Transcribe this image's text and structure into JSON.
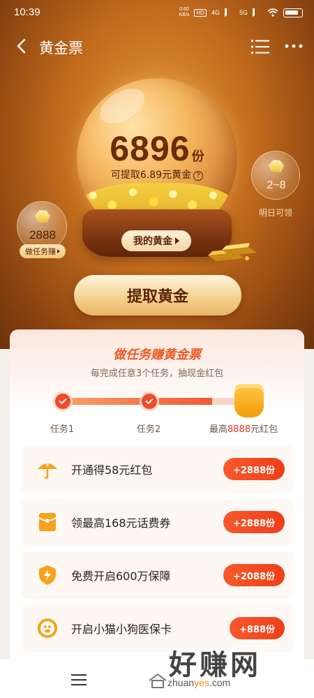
{
  "status_bar": {
    "time": "10:39",
    "net_speed": "0.60",
    "net_unit": "KB/s",
    "hd": "HD",
    "network": "4G",
    "network2": "5G"
  },
  "header": {
    "title": "黄金票"
  },
  "gold": {
    "amount": "6896",
    "unit": "份",
    "withdrawable": "可提取6.89元黄金",
    "my_gold_button": "我的黄金"
  },
  "bubble_left": {
    "count": "2888",
    "pill": "做任务赚"
  },
  "bubble_right": {
    "range": "2~8",
    "caption": "明日可领"
  },
  "withdraw_button": "提取黄金",
  "task_card": {
    "title": "做任务赚黄金票",
    "subtitle": "每完成任意3个任务，抽现金红包",
    "steps": [
      "任务1",
      "任务2"
    ],
    "reward_prefix": "最高",
    "reward_value": "8888",
    "reward_suffix": "元红包",
    "tasks": [
      {
        "label": "开通得58元红包",
        "reward": "+2888份",
        "icon": "umbrella-coin-icon"
      },
      {
        "label": "领最高168元话费券",
        "reward": "+2888份",
        "icon": "red-envelope-icon"
      },
      {
        "label": "免费开启600万保障",
        "reward": "+2088份",
        "icon": "shield-bolt-icon"
      },
      {
        "label": "开启小猫小狗医保卡",
        "reward": "+888份",
        "icon": "pet-coin-icon"
      }
    ]
  },
  "watermark": {
    "text": "好赚网",
    "url_a": "zhuan",
    "url_b": "yes",
    "url_c": ".com"
  },
  "colors": {
    "accent": "#ef3f18",
    "hero": "#c06a1c",
    "title_orange": "#ec5a23"
  }
}
